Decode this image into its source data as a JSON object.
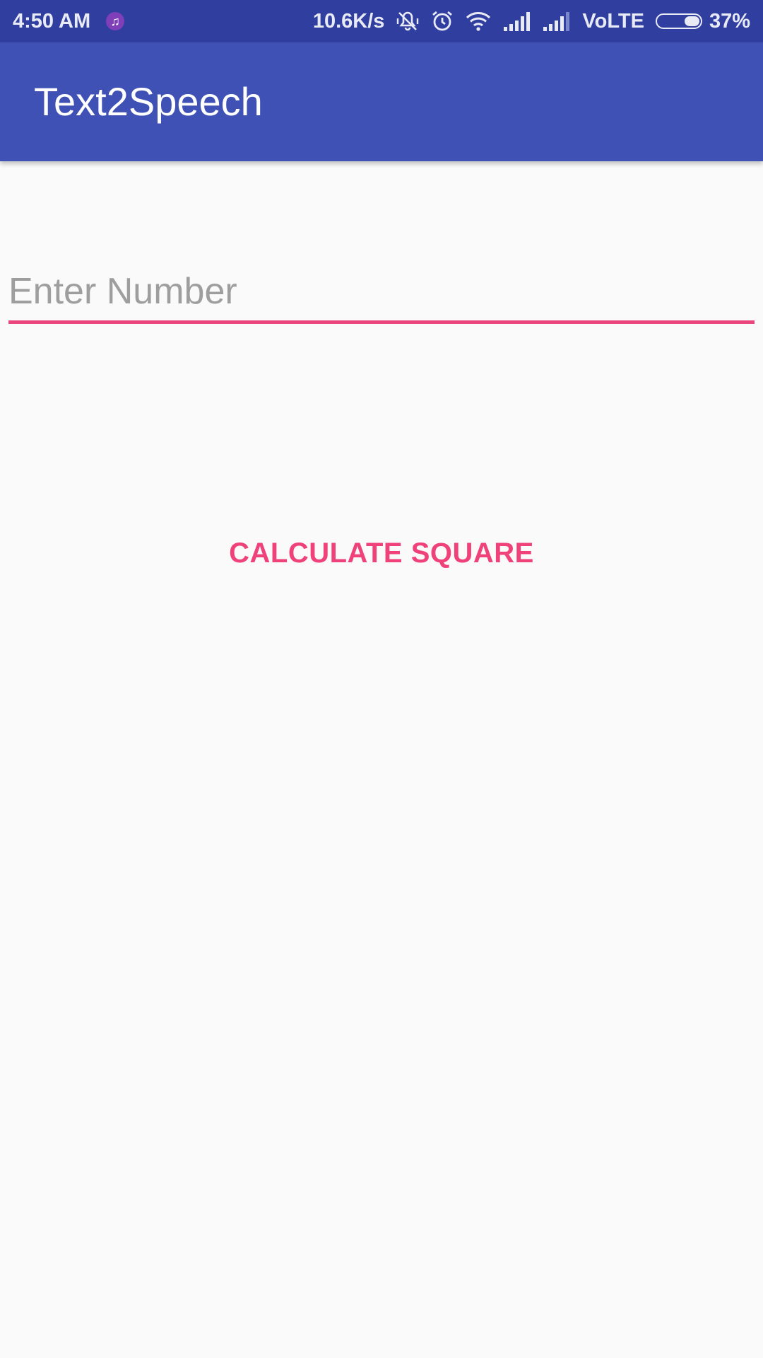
{
  "status_bar": {
    "time": "4:50 AM",
    "network_speed": "10.6K/s",
    "network_type": "VoLTE",
    "battery_percent": "37%",
    "battery_level": 0.37,
    "icons": [
      "music-notification-icon",
      "vibrate-icon",
      "alarm-icon",
      "wifi-icon",
      "signal-icon",
      "signal-icon"
    ]
  },
  "app_bar": {
    "title": "Text2Speech"
  },
  "form": {
    "input_value": "",
    "input_placeholder": "Enter Number",
    "button_label": "CALCULATE SQUARE"
  },
  "colors": {
    "status_bar": "#303f9f",
    "app_bar": "#3f51b5",
    "accent": "#f0427a",
    "background": "#fafafa"
  }
}
